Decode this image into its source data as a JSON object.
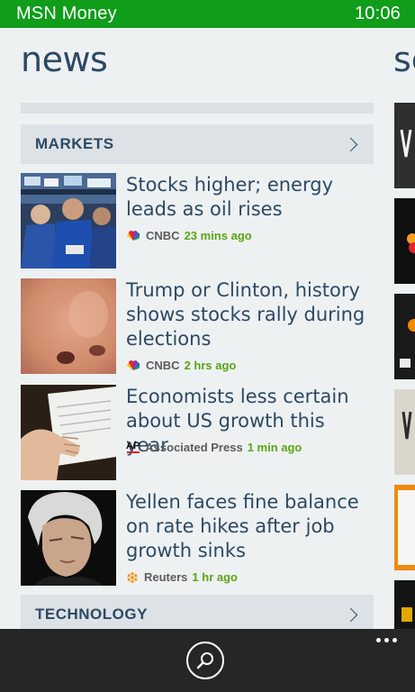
{
  "status_bar": {
    "app_name": "MSN Money",
    "time": "10:06",
    "color": "#0f9d1a"
  },
  "page": {
    "title": "news",
    "next_title": "sc"
  },
  "sections": {
    "markets": "MARKETS",
    "technology": "TECHNOLOGY"
  },
  "articles": [
    {
      "headline": "Stocks higher; energy leads as oil rises",
      "source": "CNBC",
      "source_icon": "cnbc-peacock-icon",
      "time": "23 mins ago"
    },
    {
      "headline": "Trump or Clinton, history shows stocks rally during elections",
      "source": "CNBC",
      "source_icon": "cnbc-peacock-icon",
      "time": "2 hrs ago"
    },
    {
      "headline": "Economists less certain about US growth this year",
      "source": "Associated Press",
      "source_icon": "ap-logo-icon",
      "ap_logo_text": "AP",
      "time": "1 min ago"
    },
    {
      "headline": "Yellen faces fine balance on rate hikes after job growth sinks",
      "source": "Reuters",
      "source_icon": "reuters-logo-icon",
      "time": "1 hr ago"
    }
  ],
  "app_bar": {
    "search_icon": "search-icon",
    "more_icon": "more-icon"
  },
  "colors": {
    "accent_green": "#5aa516",
    "title_blue": "#2c4964",
    "background": "#eef1f2",
    "app_bar": "#262626"
  }
}
